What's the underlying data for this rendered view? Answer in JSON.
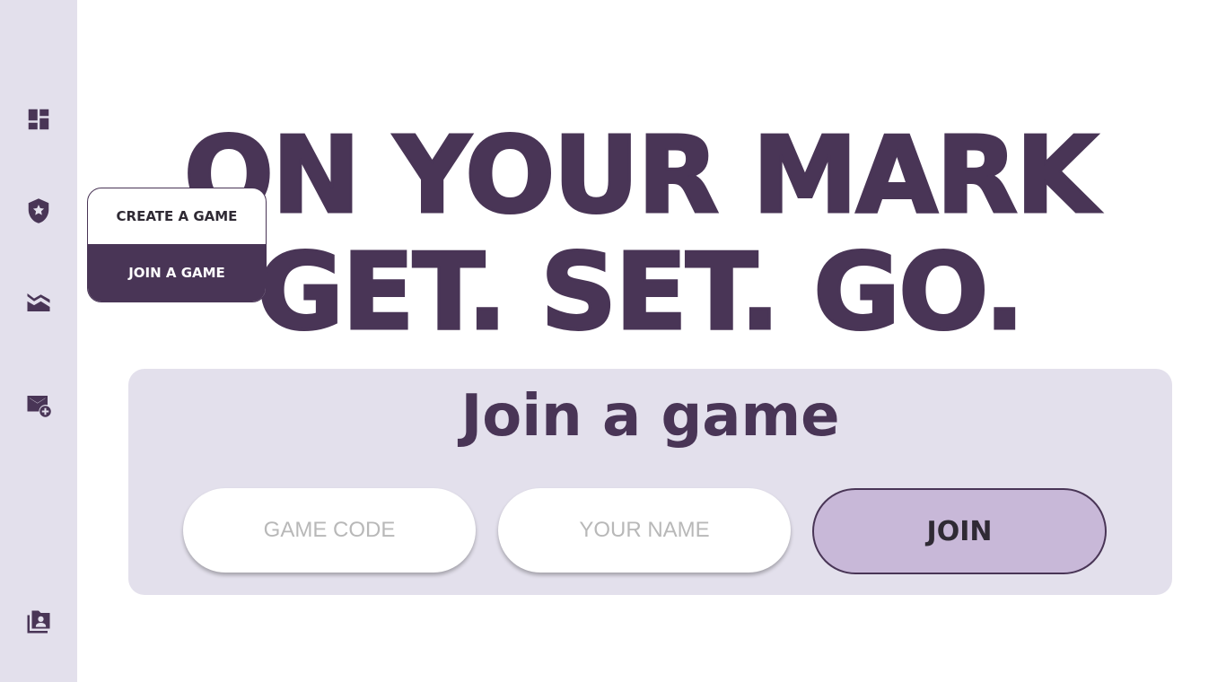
{
  "sidebar": {
    "icons": [
      {
        "name": "dashboard-icon"
      },
      {
        "name": "badge-star-icon"
      },
      {
        "name": "chart-area-icon"
      },
      {
        "name": "mail-add-icon"
      },
      {
        "name": "contact-folder-icon"
      }
    ]
  },
  "headline": {
    "line1": "ON YOUR MARK",
    "line2": "GET. SET. GO."
  },
  "popup_menu": {
    "items": [
      {
        "label": "CREATE A GAME",
        "selected": false
      },
      {
        "label": "JOIN A GAME",
        "selected": true
      }
    ]
  },
  "join_panel": {
    "title": "Join a game",
    "game_code": {
      "placeholder": "GAME CODE",
      "value": ""
    },
    "your_name": {
      "placeholder": "YOUR NAME",
      "value": ""
    },
    "join_label": "JOIN"
  },
  "colors": {
    "primary": "#493556",
    "sidebar_bg": "#e3e0ec",
    "panel_bg": "#e3e0ec",
    "join_button_bg": "#c8b8d8"
  }
}
